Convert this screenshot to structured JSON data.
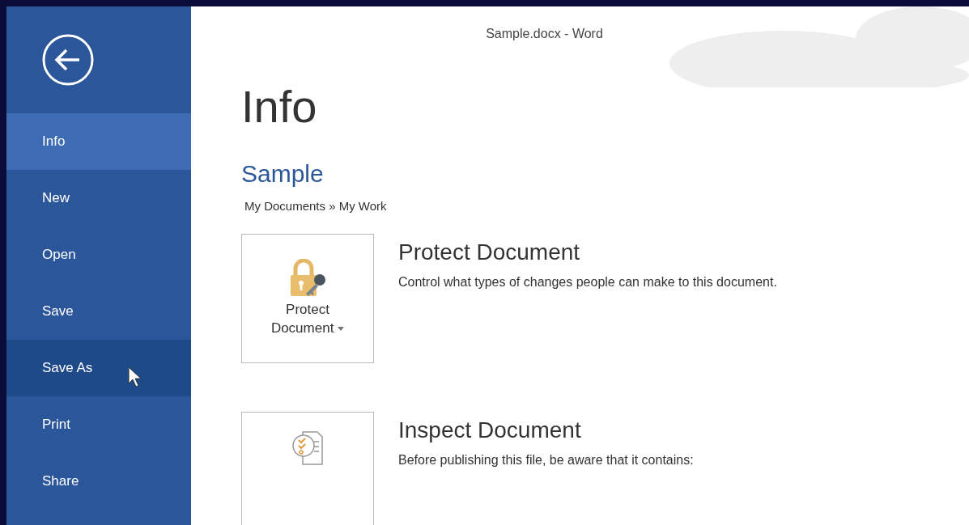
{
  "window": {
    "title": "Sample.docx - Word"
  },
  "sidebar": {
    "items": [
      {
        "label": "Info",
        "selected": true,
        "hovered": false
      },
      {
        "label": "New",
        "selected": false,
        "hovered": false
      },
      {
        "label": "Open",
        "selected": false,
        "hovered": false
      },
      {
        "label": "Save",
        "selected": false,
        "hovered": false
      },
      {
        "label": "Save As",
        "selected": false,
        "hovered": true
      },
      {
        "label": "Print",
        "selected": false,
        "hovered": false
      },
      {
        "label": "Share",
        "selected": false,
        "hovered": false
      }
    ]
  },
  "page": {
    "heading": "Info",
    "document_name": "Sample",
    "path": "My Documents » My Work"
  },
  "sections": [
    {
      "kind": "protect",
      "button_label": "Protect Document",
      "dropdown": true,
      "title": "Protect Document",
      "description": "Control what types of changes people can make to this document."
    },
    {
      "kind": "inspect",
      "title": "Inspect Document",
      "description": "Before publishing this file, be aware that it contains:"
    }
  ]
}
